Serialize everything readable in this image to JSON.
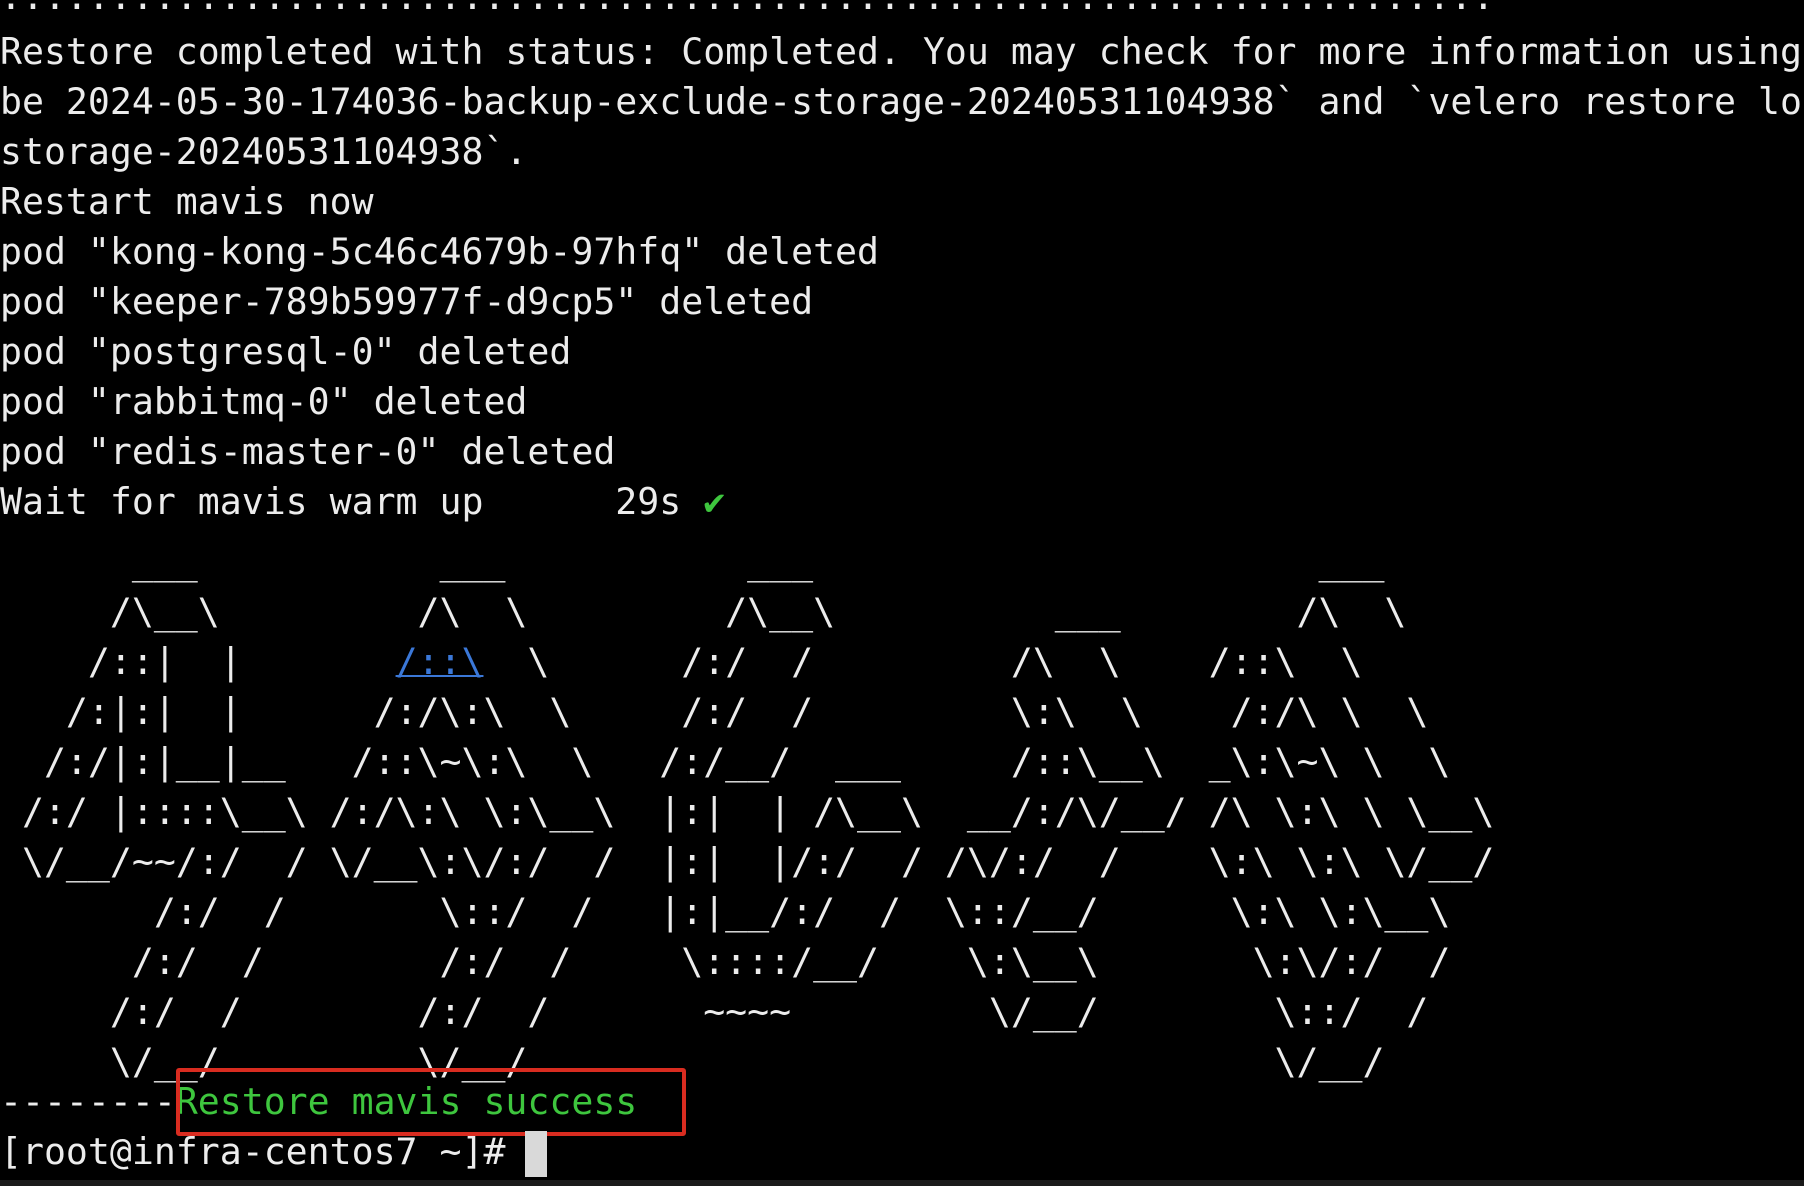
{
  "terminal": {
    "dots_line": "....................................................................",
    "lines": [
      "Restore completed with status: Completed. You may check for more information using",
      "be 2024-05-30-174036-backup-exclude-storage-20240531104938` and `velero restore log",
      "storage-20240531104938`.",
      "Restart mavis now",
      "pod \"kong-kong-5c46c4679b-97hfq\" deleted",
      "pod \"keeper-789b59977f-d9cp5\" deleted",
      "pod \"postgresql-0\" deleted",
      "pod \"rabbitmq-0\" deleted",
      "pod \"redis-master-0\" deleted"
    ],
    "wait_label": "Wait for mavis warm up      29s ",
    "check_mark": "✔",
    "ascii_art": [
      "      ___           ___           ___                       ___     ",
      "     /\\__\\         /\\  \\         /\\__\\          ___        /\\  \\    ",
      "    /::|  |       ",
      "   /:|:|  |      /:/\\:\\  \\     /:/  /         \\:\\  \\    /:/\\ \\  \\  ",
      "  /:/|:|__|__   /::\\~\\:\\  \\   /:/__/  ___     /::\\__\\  _\\:\\~\\ \\  \\ ",
      " /:/ |::::\\__\\ /:/\\:\\ \\:\\__\\  |:|  | /\\__\\  __/:/\\/__/ /\\ \\:\\ \\ \\__\\",
      " \\/__/~~/:/  / \\/__\\:\\/:/  /  |:|  |/:/  / /\\/:/  /    \\:\\ \\:\\ \\/__/",
      "       /:/  /       \\::/  /   |:|__/:/  /  \\::/__/      \\:\\ \\:\\__\\  ",
      "      /:/  /        /:/  /     \\::::/__/    \\:\\__\\       \\:\\/:/  /  ",
      "     /:/  /        /:/  /       ~~~~         \\/__/        \\::/  /   ",
      "     \\/__/         \\/__/                                  \\/__/    "
    ],
    "ascii_row3_link": "/::\\",
    "ascii_row3_rest": "  \\      /:/  /         /\\  \\    /::\\  \\  ",
    "ascii_row2_part2": "     ___   ",
    "dashes": "--------",
    "success_text": "Restore mavis success",
    "prompt": "[root@infra-centos7 ~]# "
  },
  "colors": {
    "background": "#000000",
    "text": "#ececec",
    "success": "#3ec63e",
    "link": "#3b78d8",
    "highlight_border": "#d92c20"
  }
}
